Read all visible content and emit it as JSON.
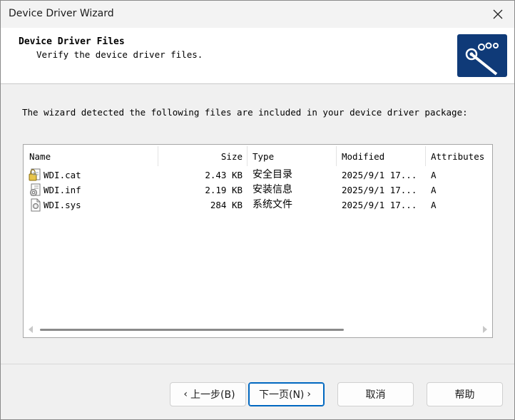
{
  "window": {
    "title": "Device Driver Wizard"
  },
  "header": {
    "title": "Device Driver Files",
    "subtitle": "Verify the device driver files."
  },
  "intro_text": "The wizard detected the following files are included in your device driver package:",
  "file_list": {
    "columns": [
      "Name",
      "Size",
      "Type",
      "Modified",
      "Attributes"
    ],
    "rows": [
      {
        "name": "WDI.cat",
        "size": "2.43 KB",
        "type": "安全目录",
        "modified": "2025/9/1 17...",
        "attributes": "A",
        "icon": "security-catalog-icon"
      },
      {
        "name": "WDI.inf",
        "size": "2.19 KB",
        "type": "安装信息",
        "modified": "2025/9/1 17...",
        "attributes": "A",
        "icon": "setup-information-icon"
      },
      {
        "name": "WDI.sys",
        "size": "284 KB",
        "type": "系统文件",
        "modified": "2025/9/1 17...",
        "attributes": "A",
        "icon": "system-file-icon"
      }
    ]
  },
  "buttons": {
    "back": "上一步(B)",
    "next": "下一页(N)",
    "cancel": "取消",
    "help": "帮助"
  },
  "colors": {
    "accent": "#0067c0",
    "logo_bg": "#0f3a78"
  }
}
